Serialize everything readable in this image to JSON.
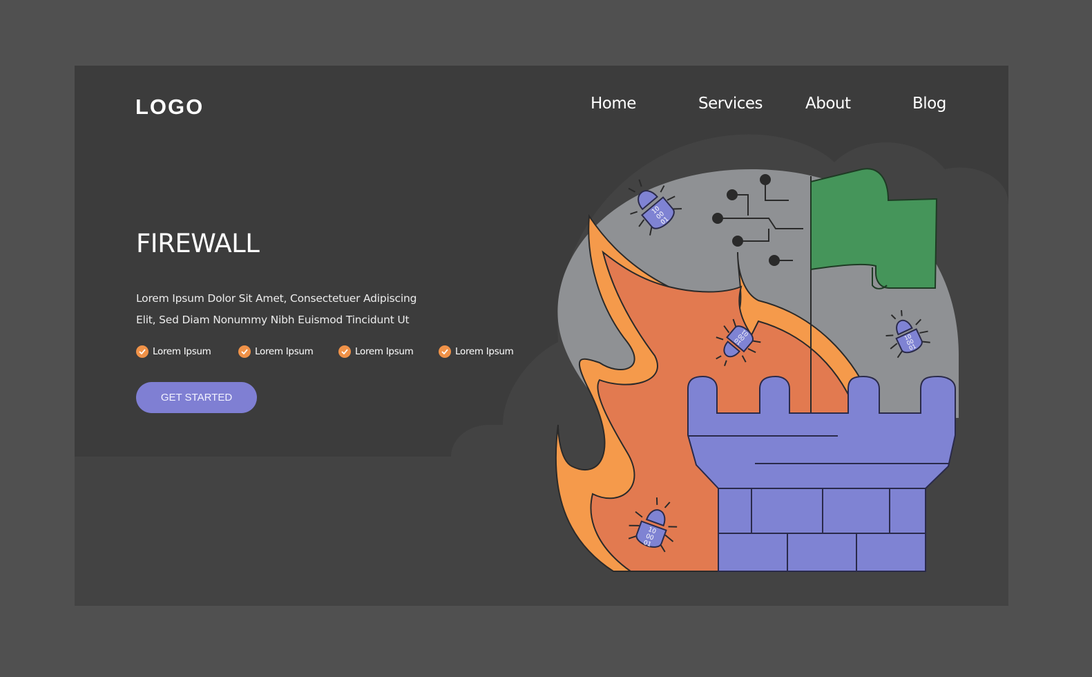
{
  "header": {
    "logo": "LOGO",
    "nav": [
      {
        "label": "Home"
      },
      {
        "label": "Services"
      },
      {
        "label": "About"
      },
      {
        "label": "Blog"
      }
    ]
  },
  "hero": {
    "title": "FIREWALL",
    "description": "Lorem Ipsum Dolor Sit Amet, Consectetuer Adipiscing Elit, Sed Diam Nonummy Nibh Euismod Tincidunt Ut",
    "features": [
      {
        "label": "Lorem Ipsum",
        "icon": "check-circle-icon"
      },
      {
        "label": "Lorem Ipsum",
        "icon": "check-circle-icon"
      },
      {
        "label": "Lorem Ipsum",
        "icon": "check-circle-icon"
      },
      {
        "label": "Lorem Ipsum",
        "icon": "check-circle-icon"
      }
    ],
    "cta_label": "GET STARTED"
  },
  "illustration": {
    "bugs": [
      {
        "code": [
          "10",
          "00",
          "01"
        ]
      },
      {
        "code": [
          "10",
          "00",
          "01"
        ]
      },
      {
        "code": [
          "10",
          "00",
          "01"
        ]
      },
      {
        "code": [
          "10",
          "00",
          "01"
        ]
      }
    ]
  },
  "colors": {
    "page_bg": "#505050",
    "card_bg": "#3c3c3c",
    "accent_purple": "#7f7fd3",
    "check_orange": "#f09248",
    "flame_outer": "#f59a4b",
    "flame_inner": "#e27a50",
    "flag_green": "#45955a",
    "circle_gray": "#8f9194"
  }
}
